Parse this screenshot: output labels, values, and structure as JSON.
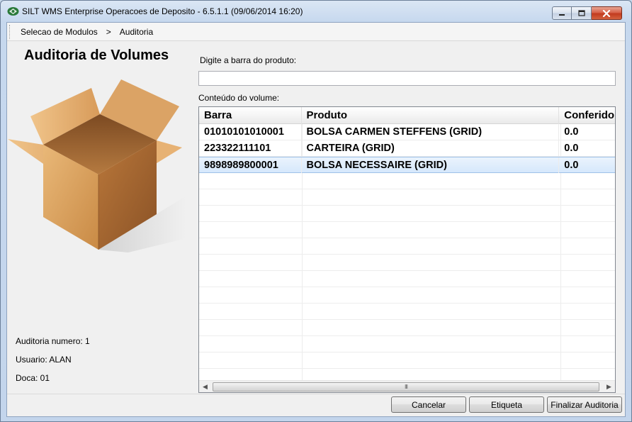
{
  "window": {
    "title": "SILT WMS Enterprise Operacoes de Deposito - 6.5.1.1 (09/06/2014 16:20)"
  },
  "breadcrumb": {
    "items": [
      "Selecao de Modulos",
      "Auditoria"
    ],
    "separator": ">"
  },
  "page": {
    "title": "Auditoria de Volumes"
  },
  "info": {
    "auditoria": "Auditoria numero: 1",
    "usuario": "Usuario: ALAN",
    "doca": "Doca: 01"
  },
  "barcode": {
    "label": "Digite a barra do produto:",
    "value": ""
  },
  "volume": {
    "label": "Conteúdo do volume:",
    "columns": [
      "Barra",
      "Produto",
      "Conferido"
    ],
    "rows": [
      {
        "barra": "01010101010001",
        "produto": "BOLSA CARMEN STEFFENS (GRID)",
        "conferido": "0.0"
      },
      {
        "barra": "223322111101",
        "produto": "CARTEIRA (GRID)",
        "conferido": "0.0"
      },
      {
        "barra": "9898989800001",
        "produto": "BOLSA NECESSAIRE (GRID)",
        "conferido": "0.0"
      }
    ],
    "selected_row": 2
  },
  "scrollbar": {
    "grip": "III"
  },
  "buttons": {
    "cancelar": "Cancelar",
    "etiqueta": "Etiqueta",
    "finalizar": "Finalizar Auditoria"
  },
  "colors": {
    "selection": "#d6e8fc",
    "box_light": "#e8b77a",
    "box_dark": "#a8692c",
    "close_button": "#c94a2c"
  },
  "icons": [
    "app-icon",
    "minimize-icon",
    "maximize-icon",
    "close-icon",
    "box-illustration",
    "scroll-left-icon",
    "scroll-right-icon"
  ]
}
